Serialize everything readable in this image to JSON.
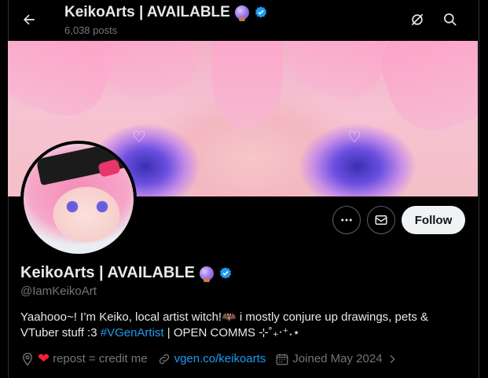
{
  "header": {
    "title": "KeikoArts | AVAILABLE",
    "posts": "6,038 posts"
  },
  "profile": {
    "name": "KeikoArts | AVAILABLE",
    "handle": "@IamKeikoArt",
    "bio_line1": "Yaahooo~! I’m Keiko, local artist witch!🦇 i mostly conjure up drawings, pets &",
    "bio_line2_pre": "VTuber stuff :3 ",
    "bio_hashtag": "#VGenArtist",
    "bio_line2_post": " | OPEN COMMS ⊹˚₊‧⁺˖⋆",
    "location_text": "repost = credit me",
    "location_heart": "❤",
    "website": "vgen.co/keikoarts",
    "joined": "Joined May 2024"
  },
  "actions": {
    "follow_label": "Follow",
    "more_label": "•••"
  },
  "colors": {
    "accent": "#1d9bf0",
    "heart": "#f4212e",
    "follow_bg": "#eff3f4"
  },
  "icons": [
    "back-arrow-icon",
    "grok-icon",
    "search-icon",
    "more-icon",
    "mail-icon",
    "verified-icon",
    "orb-icon",
    "location-icon",
    "link-icon",
    "calendar-icon",
    "chevron-right-icon"
  ]
}
